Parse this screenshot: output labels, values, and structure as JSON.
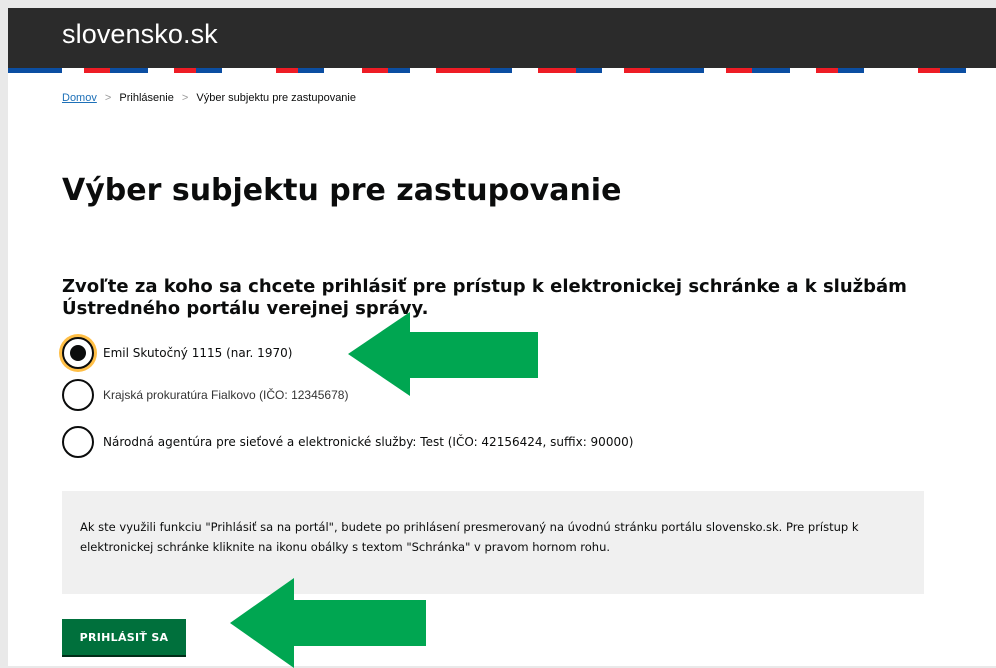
{
  "header": {
    "logo": "slovensko.sk"
  },
  "breadcrumb": {
    "home": "Domov",
    "separator": ">",
    "items": [
      "Prihlásenie",
      "Výber subjektu pre zastupovanie"
    ]
  },
  "title": "Výber subjektu pre zastupovanie",
  "question": "Zvoľte za koho sa chcete prihlásiť pre prístup k elektronickej schránke a k službám Ústredného portálu verejnej správy.",
  "options": [
    {
      "label": "Emil Skutočný 1115 (nar. 1970)",
      "checked": true
    },
    {
      "label": "Krajská prokuratúra Fialkovo (IČO: 12345678)",
      "checked": false
    },
    {
      "label": "Národná agentúra pre sieťové a elektronické služby: Test (IČO: 42156424, suffix: 90000)",
      "checked": false
    }
  ],
  "info_text": "Ak ste využili funkciu \"Prihlásiť sa na portál\", budete po prihlásení presmerovaný na úvodnú stránku portálu slovensko.sk. Pre prístup k elektronickej schránke kliknite na ikonu obálky s textom \"Schránka\" v pravom hornom rohu.",
  "login_button": "PRIHLÁSIŤ SA",
  "colors": {
    "header": "#2b2b2b",
    "stripe": [
      "#0b4ea2",
      "#ffffff",
      "#ee1c25"
    ],
    "button": "#00703c",
    "arrow": "#00a651",
    "focus": "#ffbf47"
  },
  "annotations": [
    "green-arrow-pointing-left",
    "green-arrow-pointing-left"
  ]
}
